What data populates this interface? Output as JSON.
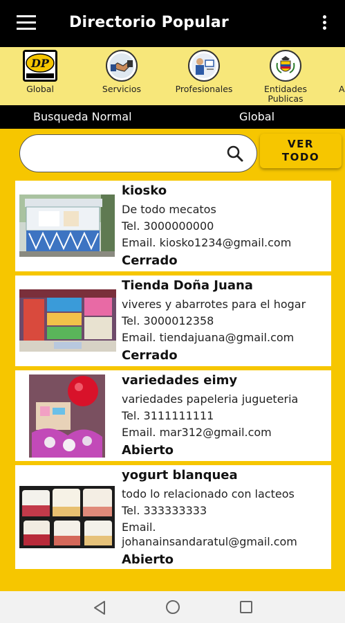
{
  "app": {
    "title": "Directorio Popular"
  },
  "categories": [
    {
      "label": "Global",
      "icon": "directorio-popular-logo-icon"
    },
    {
      "label": "Servicios",
      "icon": "handshake-icon"
    },
    {
      "label": "Profesionales",
      "icon": "professional-icon"
    },
    {
      "label": "Entidades Publicas",
      "icon": "coat-of-arms-icon"
    },
    {
      "label": "A",
      "icon": ""
    }
  ],
  "subbar": {
    "left": "Busqueda Normal",
    "right": "Global"
  },
  "search": {
    "placeholder": "",
    "value": "",
    "ver_todo": "VER TODO"
  },
  "listings": [
    {
      "name": "kiosko",
      "description": "De todo mecatos",
      "tel": "Tel. 3000000000",
      "email": "Email. kiosko1234@gmail.com",
      "status": "Cerrado"
    },
    {
      "name": "Tienda Doña Juana",
      "description": "viveres y abarrotes para el hogar",
      "tel": "Tel. 3000012358",
      "email": "Email. tiendajuana@gmail.com",
      "status": "Cerrado"
    },
    {
      "name": "variedades eimy",
      "description": "variedades papeleria jugueteria",
      "tel": "Tel. 3111111111",
      "email": "Email. mar312@gmail.com",
      "status": "Abierto"
    },
    {
      "name": "yogurt blanquea",
      "description": "todo lo relacionado con lacteos",
      "tel": "Tel. 333333333",
      "email_line1": "Email.",
      "email_line2": "johanainsandaratul@gmail.com",
      "status": "Abierto"
    }
  ],
  "colors": {
    "accent": "#f6c600",
    "appbar": "#000000",
    "category_bar": "#f7e77a"
  }
}
